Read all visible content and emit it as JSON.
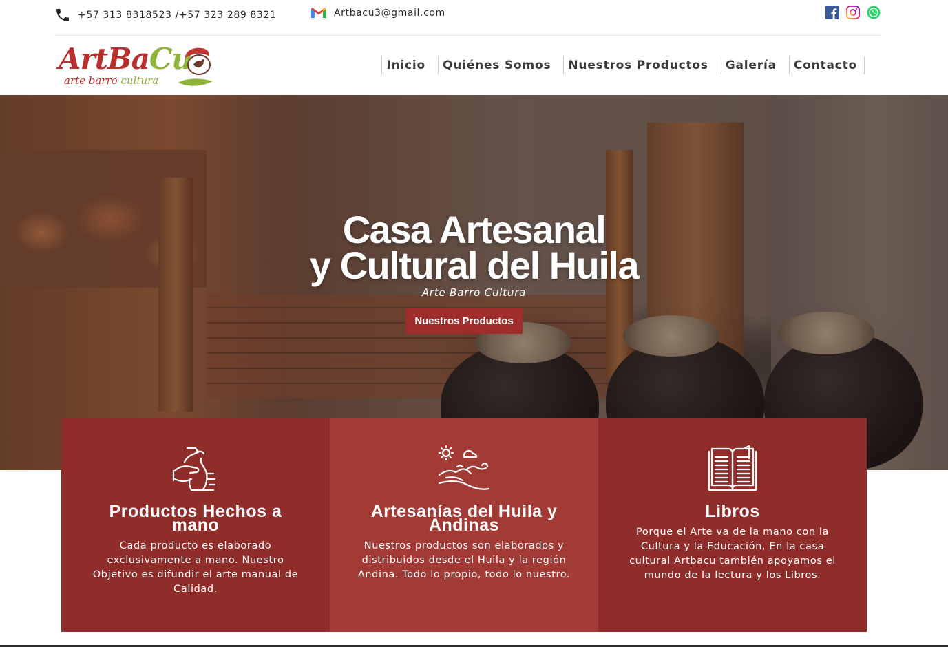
{
  "topbar": {
    "phone": "+57 313 8318523 /+57 323 289 8321",
    "email": "Artbacu3@gmail.com",
    "phone_icon": "phone-icon",
    "email_icon": "gmail-icon",
    "socials": [
      "facebook-icon",
      "instagram-icon",
      "whatsapp-icon"
    ]
  },
  "logo": {
    "main_part1": "Art",
    "main_part2": "Ba",
    "main_part3": "Cu",
    "sub_part1": "arte barro ",
    "sub_part2": "cultura"
  },
  "nav": {
    "items": [
      "Inicio",
      "Quiénes Somos",
      "Nuestros Productos",
      "Galería",
      "Contacto"
    ]
  },
  "hero": {
    "title_line1": "Casa Artesanal",
    "title_line2": "y Cultural del Huila",
    "subtitle": "Arte Barro Cultura",
    "button": "Nuestros Productos"
  },
  "cards": [
    {
      "icon": "pottery-hands-icon",
      "title": "Productos Hechos a mano",
      "text": "Cada producto es elaborado exclusivamente a mano. Nuestro Objetivo es difundir el arte manual de Calidad."
    },
    {
      "icon": "landscape-icon",
      "title": "Artesanías del Huila y Andinas",
      "text": "Nuestros productos son elaborados y distribuidos desde el Huila y la región Andina. Todo lo propio, todo lo nuestro."
    },
    {
      "icon": "open-book-icon",
      "title": "Libros",
      "text": "Porque el Arte va de la mano con la Cultura y la Educación, En la casa cultural Artbacu también apoyamos el mundo de la lectura y los Libros."
    }
  ],
  "colors": {
    "brand_red": "#9e2d2c",
    "card_dark": "#8e2d2a",
    "card_mid": "#a23a36",
    "brand_green": "#8fb43a"
  }
}
